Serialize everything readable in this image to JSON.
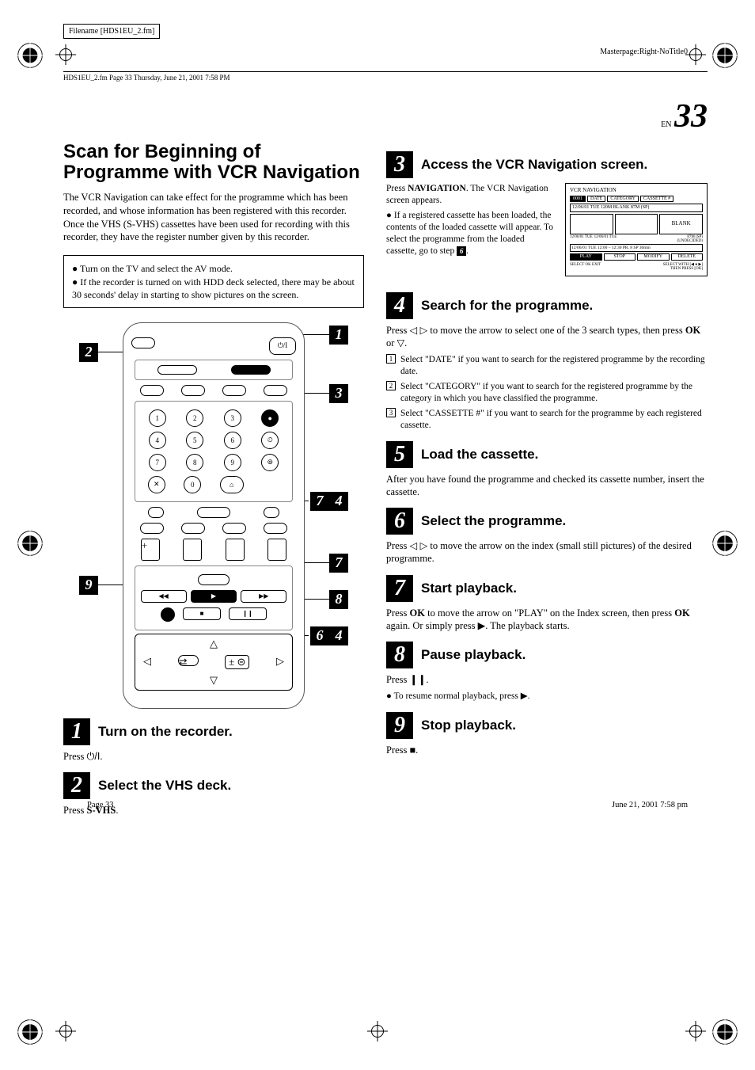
{
  "doc": {
    "filename": "Filename [HDS1EU_2.fm]",
    "header_left": "HDS1EU_2.fm  Page 33  Thursday, June 21, 2001  7:58 PM",
    "masterpage": "Masterpage:Right-NoTitle0",
    "lang_code": "EN",
    "page_num": "33",
    "footer_left": "Page 33",
    "footer_right": "June 21, 2001 7:58 pm"
  },
  "left": {
    "h1": "Scan for Beginning of Programme with VCR Navigation",
    "intro": "The VCR Navigation can take effect for the programme which has been recorded, and whose information has been registered with this recorder. Once the VHS (S-VHS) cassettes have been used for recording with this recorder, they have the register number given by this recorder.",
    "box_items": [
      "Turn on the TV and select the AV mode.",
      "If the recorder is turned on with HDD deck selected, there may be about 30 seconds' delay in starting to show pictures on the screen."
    ],
    "remote_callouts": {
      "c1": "1",
      "c2": "2",
      "c3": "3",
      "c4": "4",
      "c6": "6",
      "c7": "7",
      "c8": "8",
      "c9": "9"
    },
    "remote_keys": {
      "k1": "1",
      "k2": "2",
      "k3": "3",
      "k4": "4",
      "k5": "5",
      "k6": "6",
      "k7": "7",
      "k8": "8",
      "k9": "9",
      "k0": "0"
    },
    "step1": {
      "n": "1",
      "title": "Turn on the recorder.",
      "body_prefix": "Press ",
      "body_symbol": "⏻/I",
      "body_suffix": "."
    },
    "step2": {
      "n": "2",
      "title": "Select the VHS deck.",
      "body": "Press S-VHS."
    }
  },
  "right": {
    "step3": {
      "n": "3",
      "title": "Access the VCR Navigation screen.",
      "para": "Press NAVIGATION. The VCR Navigation screen appears.",
      "bullet": "If a registered cassette has been loaded, the contents of the loaded cassette will appear. To select the programme from the loaded cassette, go to step ",
      "bullet_step": "6",
      "bullet_after": "."
    },
    "navfig": {
      "title": "VCR NAVIGATION",
      "tab1": "0001",
      "tab2": "DATE",
      "tab3": "CATEGORY",
      "tab4": "CASSETTE #",
      "bar": "12/06/01 TUE    120M       BLANK   87M (SP)",
      "blank": "BLANK",
      "row2a": "12/06/01 TUE",
      "row2b": "12/06/01 TUE",
      "row2c": "87M (SP)",
      "info": "12/06/01  TUE  12:00 – 12:30      PR.   8     SP      30min",
      "und": "(UNDECIDED)",
      "b1": "PLAY",
      "b2": "STOP",
      "b3": "MODIFY",
      "b4": "DELETE",
      "hint1": "SELECT  OK  EXIT",
      "hint2": "SELECT WITH [◀ ● ▶]",
      "hint3": "THEN PRESS [OK]"
    },
    "step4": {
      "n": "4",
      "title": "Search for the programme.",
      "body": "Press ◁ ▷ to move the arrow to select one of the 3 search types, then press OK or ▽.",
      "i1": "Select \"DATE\" if you want to search for the registered programme by the recording date.",
      "i2": "Select \"CATEGORY\" if you want to search for the registered programme by the category in which you have classified the programme.",
      "i3": "Select \"CASSETTE #\" if you want to search for the programme by each registered cassette."
    },
    "step5": {
      "n": "5",
      "title": "Load the cassette.",
      "body": "After you have found the programme and checked its cassette number, insert the cassette."
    },
    "step6": {
      "n": "6",
      "title": "Select the programme.",
      "body": "Press ◁ ▷ to move the arrow on the index (small still pictures) of the desired programme."
    },
    "step7": {
      "n": "7",
      "title": "Start playback.",
      "body": "Press OK to move the arrow on \"PLAY\" on the Index screen, then press OK again. Or simply press ▶. The playback starts."
    },
    "step8": {
      "n": "8",
      "title": "Pause playback.",
      "body": "Press ❙❙.",
      "bullet": "To resume normal playback, press ▶."
    },
    "step9": {
      "n": "9",
      "title": "Stop playback.",
      "body": "Press ■."
    }
  }
}
